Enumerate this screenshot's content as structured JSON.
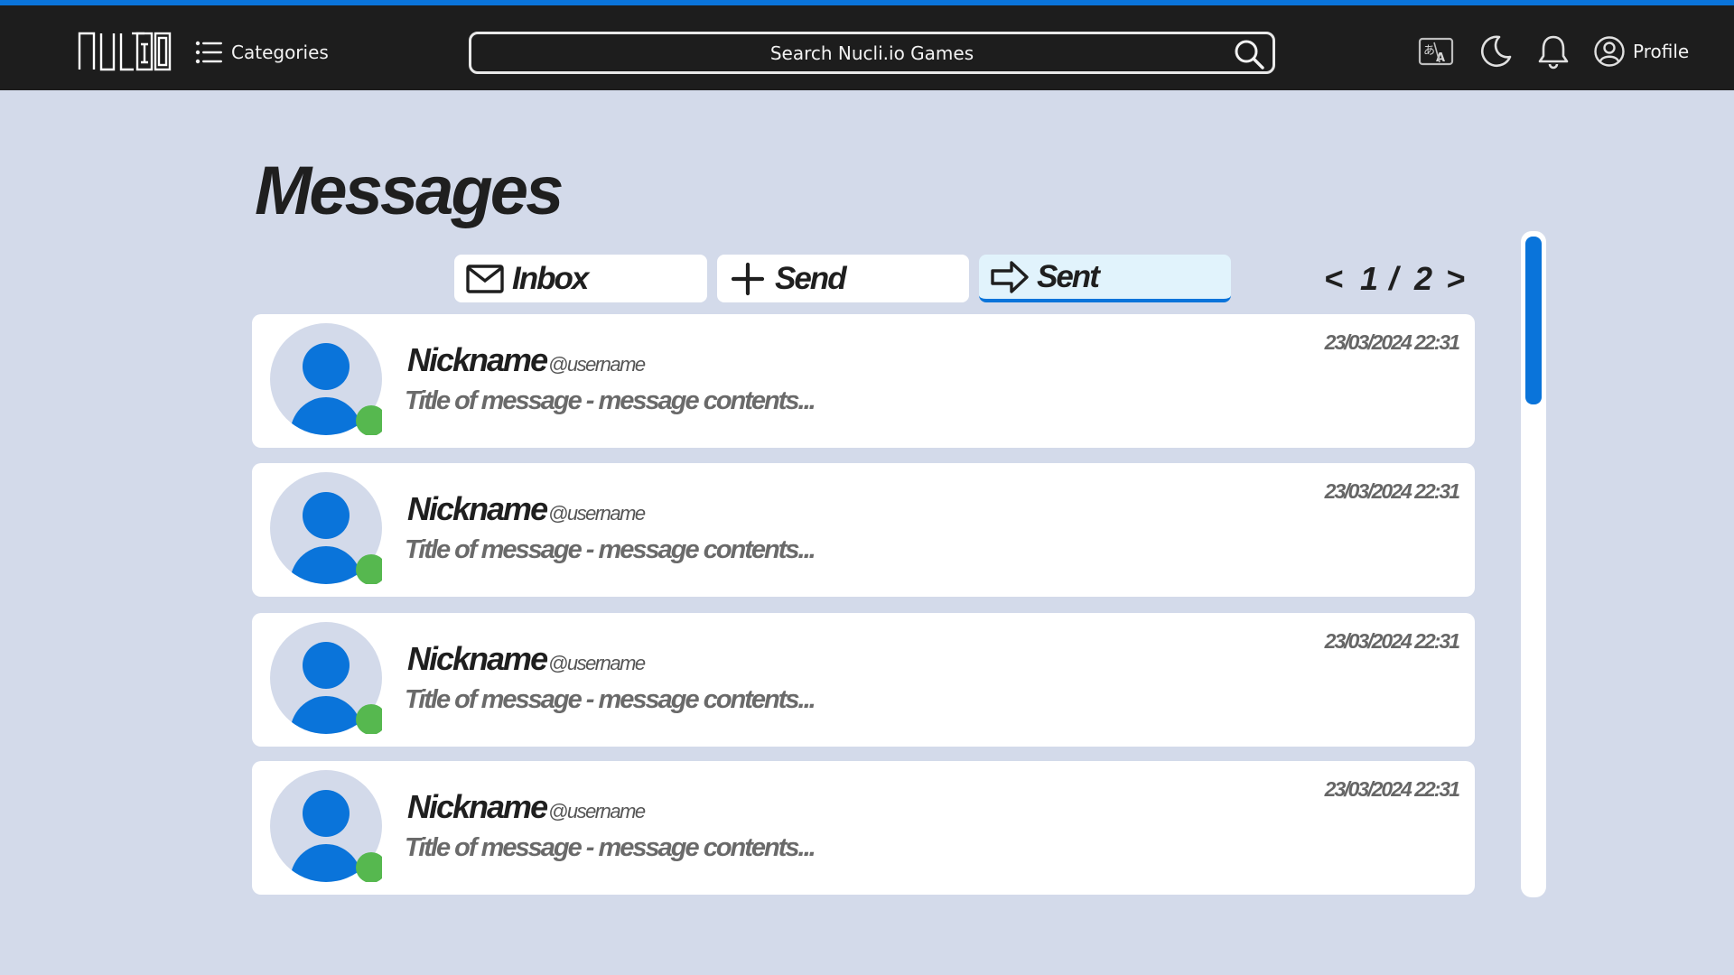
{
  "colors": {
    "accent": "#0a74da",
    "topbar": "#1d1d1d",
    "page_background": "#d3daea",
    "online": "#56b84f",
    "avatar_background": "#d3daea"
  },
  "header": {
    "logo_icon": "nuclio-logo",
    "categories_label": "Categories",
    "categories_icon": "list-icon",
    "search_placeholder": "Search Nucli.io Games",
    "search_icon": "search-icon",
    "language_icon": "translate-icon",
    "theme_icon": "moon-icon",
    "notification_icon": "bell-icon",
    "profile_label": "Profile",
    "profile_icon": "user-circle-icon"
  },
  "page": {
    "title": "Messages"
  },
  "tabs": [
    {
      "label": "Inbox",
      "icon": "envelope-icon",
      "active": false
    },
    {
      "label": "Send",
      "icon": "plus-icon",
      "active": false
    },
    {
      "label": "Sent",
      "icon": "arrow-right-icon",
      "active": true
    }
  ],
  "pagination": {
    "prev": "<",
    "current": "1",
    "separator": "/",
    "total": "2",
    "next": ">"
  },
  "messages": [
    {
      "nickname": "Nickname",
      "username": "@username",
      "preview": "Title of message  -  message contents...",
      "timestamp": "23/03/2024 22:31",
      "online": true
    },
    {
      "nickname": "Nickname",
      "username": "@username",
      "preview": "Title of message  -  message contents...",
      "timestamp": "23/03/2024 22:31",
      "online": true
    },
    {
      "nickname": "Nickname",
      "username": "@username",
      "preview": "Title of message  -  message contents...",
      "timestamp": "23/03/2024 22:31",
      "online": true
    },
    {
      "nickname": "Nickname",
      "username": "@username",
      "preview": "Title of message  -  message contents...",
      "timestamp": "23/03/2024 22:31",
      "online": true
    }
  ]
}
